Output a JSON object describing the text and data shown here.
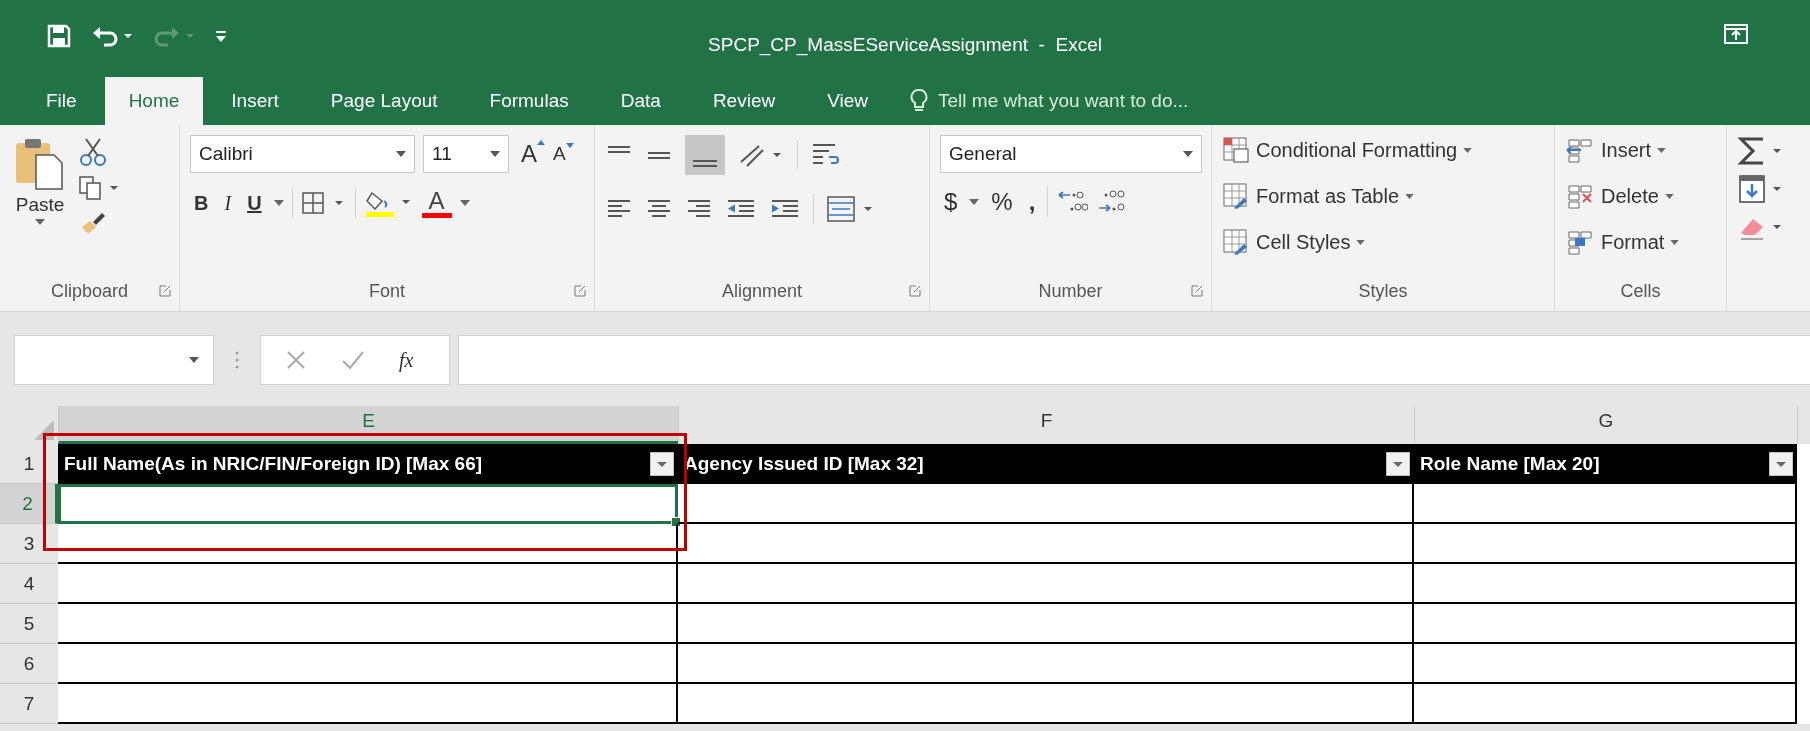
{
  "window": {
    "title": "SPCP_CP_MassEServiceAssignment  -  Excel"
  },
  "tabs": [
    {
      "label": "File",
      "selected": false
    },
    {
      "label": "Home",
      "selected": true
    },
    {
      "label": "Insert",
      "selected": false
    },
    {
      "label": "Page Layout",
      "selected": false
    },
    {
      "label": "Formulas",
      "selected": false
    },
    {
      "label": "Data",
      "selected": false
    },
    {
      "label": "Review",
      "selected": false
    },
    {
      "label": "View",
      "selected": false
    }
  ],
  "tell_me": {
    "placeholder": "Tell me what you want to do..."
  },
  "ribbon": {
    "clipboard": {
      "paste": "Paste",
      "label": "Clipboard"
    },
    "font": {
      "name": "Calibri",
      "size": "11",
      "grow": "A",
      "shrink": "A",
      "bold": "B",
      "italic": "I",
      "underline": "U",
      "font_color": "A",
      "label": "Font"
    },
    "alignment": {
      "label": "Alignment"
    },
    "number": {
      "format": "General",
      "currency": "$",
      "percent": "%",
      "comma": ",",
      "label": "Number"
    },
    "styles": {
      "items": [
        "Conditional Formatting",
        "Format as Table",
        "Cell Styles"
      ],
      "label": "Styles"
    },
    "cells": {
      "items": [
        "Insert",
        "Delete",
        "Format"
      ],
      "label": "Cells"
    }
  },
  "formula_bar": {
    "function_label": "fx"
  },
  "sheet": {
    "columns": [
      {
        "letter": "E",
        "header": "Full Name(As in NRIC/FIN/Foreign ID) [Max 66]",
        "selected": true
      },
      {
        "letter": "F",
        "header": "Agency Issued ID [Max 32]",
        "selected": false
      },
      {
        "letter": "G",
        "header": "Role Name [Max 20]",
        "selected": false
      }
    ],
    "rows": [
      {
        "number": "1",
        "selected": false
      },
      {
        "number": "2",
        "selected": true
      },
      {
        "number": "3",
        "selected": false
      },
      {
        "number": "4",
        "selected": false
      },
      {
        "number": "5",
        "selected": false
      },
      {
        "number": "6",
        "selected": false
      },
      {
        "number": "7",
        "selected": false
      }
    ]
  }
}
